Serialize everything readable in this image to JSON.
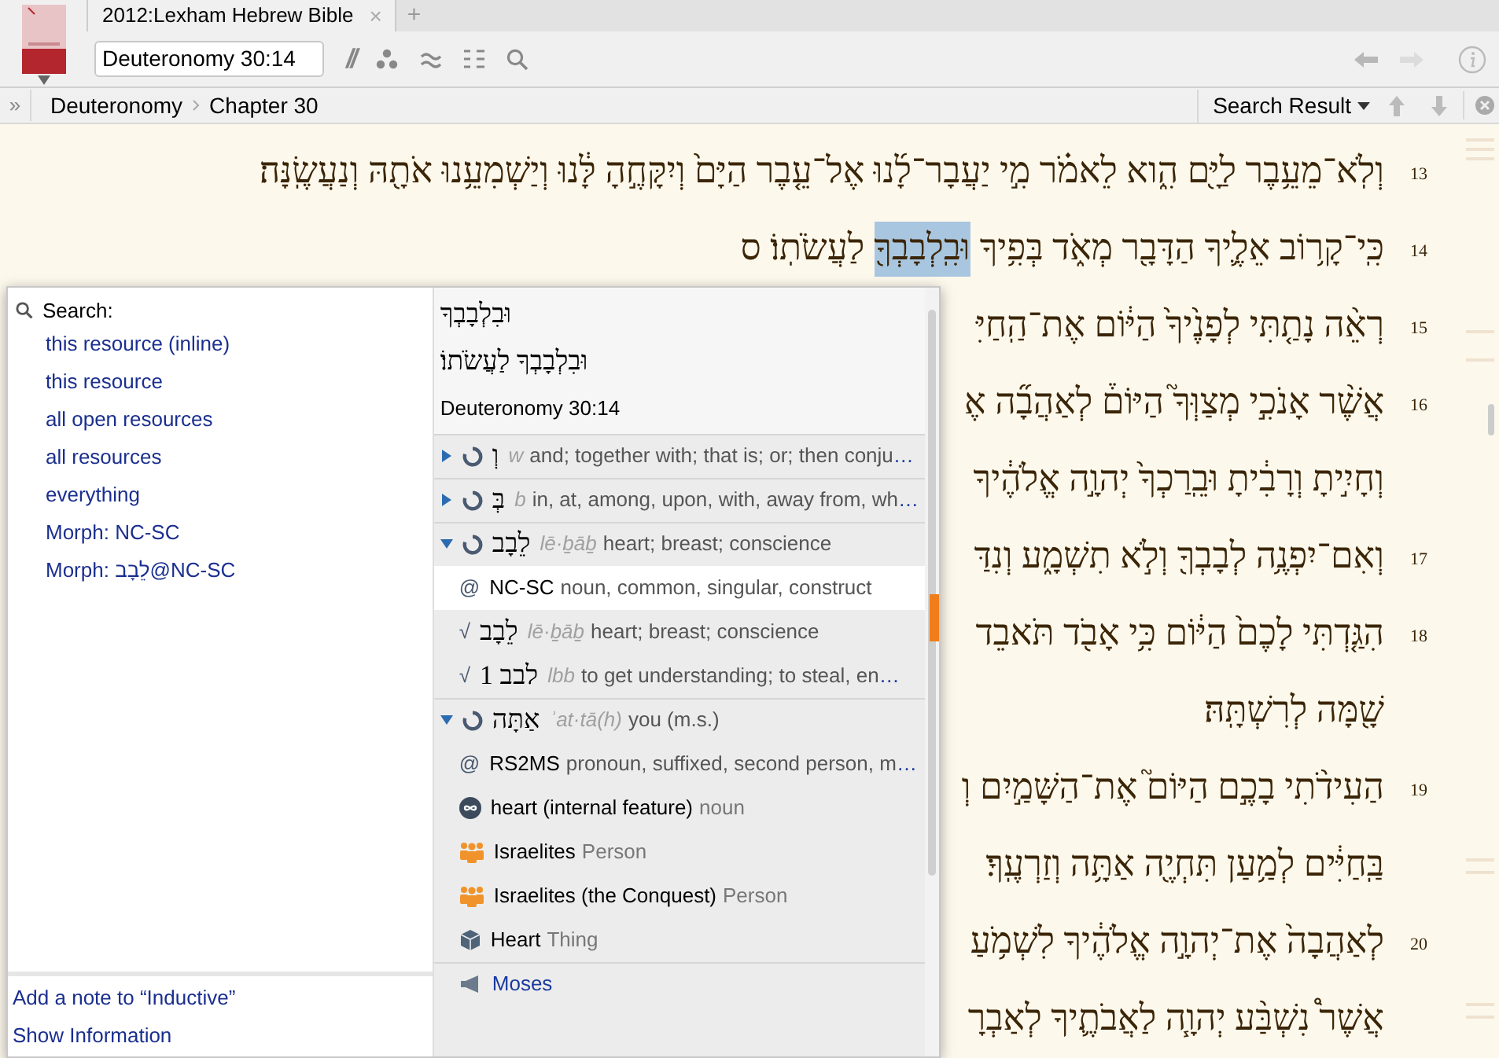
{
  "tabs": [
    {
      "label": "2012:Lexham Hebrew Bible",
      "selected": true,
      "close": "×"
    }
  ],
  "new_tab": "+",
  "reference_field": {
    "value": "Deuteronomy 30:14"
  },
  "parallel_glyph": "//",
  "breadcrumb": {
    "expand": "»",
    "book": "Deuteronomy",
    "chapter": "Chapter 30"
  },
  "search_result": {
    "label": "Search Result"
  },
  "verses": [
    {
      "number": "13",
      "segments": [
        {
          "text": "וְלֹֽא־מֵעֵ֥בֶר לַיָּ֖ם הִ֑וא לֵאמֹ֗ר מִ֣י יַעֲבָר־לָ֜נוּ אֶל־עֵ֤בֶר הַיָּם֙ וְיִקָּחֶ֣הָ לָּ֔נוּ וְיַשְׁמִעֵ֥נוּ אֹתָ֖הּ וְנַעֲשֶֽׂנָּה׃",
          "highlighted": false
        }
      ]
    },
    {
      "number": "14",
      "segments": [
        {
          "text": "כִּֽי־קָר֥וֹב אֵלֶ֛יךָ הַדָּבָ֖ר מְאֹ֑ד בְּפִ֥יךָ",
          "highlighted": false
        },
        {
          "text": "וּבִֽלְבָבְךָ֖",
          "highlighted": true
        },
        {
          "text": "לַעֲשֹׂתֽוֹ׃ ס",
          "highlighted": false
        }
      ]
    },
    {
      "number": "15",
      "segments": [
        {
          "text": "רְאֵ֨ה נָתַ֤תִּי לְפָנֶ֙יךָ֙ הַיּ֔וֹם אֶת־הַֽחַיִּ",
          "highlighted": false
        }
      ]
    },
    {
      "number": "16",
      "segments": [
        {
          "text": "אֲשֶׁ֨ר אָנֹכִ֣י מְצַוְּךָ֮ הַיּוֹם֒ לְאַהֲבָ֞ה אֶ",
          "highlighted": false
        }
      ]
    },
    {
      "segments": [
        {
          "text": "וְחָיִ֣יתָ וְרָבִ֔יתָ וּבֵֽרַכְךָ֙ יְהוָ֣ה אֱלֹהֶ֔יךָ",
          "highlighted": false
        }
      ]
    },
    {
      "number": "17",
      "segments": [
        {
          "text": "וְאִם־יִפְנֶ֥ה לְבָבְךָ֖ וְלֹ֣א תִשְׁמָ֑ע וְנִדַּ",
          "highlighted": false
        }
      ]
    },
    {
      "number": "18",
      "segments": [
        {
          "text": "הִגַּ֤דְתִּי לָכֶם֙ הַיּ֔וֹם כִּ֥י אָבֹ֖ד תֹּאבֵד",
          "highlighted": false
        }
      ]
    },
    {
      "segments": [
        {
          "text": "שָׁ֖מָּה לְרִשְׁתָּֽהּ׃",
          "highlighted": false
        }
      ]
    },
    {
      "number": "19",
      "segments": [
        {
          "text": "הַעִידֹ֨תִי בָכֶ֣ם הַיּוֹם֮ אֶת־הַשָּׁמַ֣יִם וְ",
          "highlighted": false
        }
      ]
    },
    {
      "segments": [
        {
          "text": "בַּֽחַיִּ֔ים לְמַ֥עַן תִּחְיֶ֖ה אַתָּ֥ה וְזַרְעֶֽךָ׃",
          "highlighted": false
        }
      ]
    },
    {
      "number": "20",
      "segments": [
        {
          "text": "לְאַהֲבָה֙ אֶת־יְהוָ֣ה אֱלֹהֶ֔יךָ לִשְׁמֹ֥עַ",
          "highlighted": false
        }
      ]
    },
    {
      "segments": [
        {
          "text": "אֲשֶׁר֩ נִשְׁבַּ֨ע יְהוָ֧ה לַאֲבֹתֶ֛יךָ לְאַבְרָ",
          "highlighted": false
        }
      ]
    }
  ],
  "popup": {
    "search_label": "Search:",
    "search_options": [
      "this resource (inline)",
      "this resource",
      "all open resources",
      "all resources",
      "everything",
      "Morph: NC-SC",
      "Morph: לֵבָב@NC-SC"
    ],
    "footer_links": [
      "Add a note to “Inductive”",
      "Show Information"
    ],
    "word": {
      "headword": "וּבִלְבָבְךָ",
      "phrase": "וּבִלְבָבְךָ לַעֲשֹׂתוֹ׃",
      "reference": "Deuteronomy 30:14"
    },
    "rows": [
      {
        "kind": "lemma",
        "expanded": false,
        "selected": false,
        "hebrew": "וְ",
        "translit": "w",
        "gloss": "and; together with; that is; or; then conju",
        "more": "…"
      },
      {
        "kind": "lemma",
        "expanded": false,
        "selected": false,
        "hebrew": "בְּ",
        "translit": "b",
        "gloss": "in, at, among, upon, with, away from, wh",
        "more": "…"
      },
      {
        "kind": "lemma",
        "expanded": true,
        "selected": false,
        "hebrew": "לֵבָב",
        "translit": "lē·ḇāḇ",
        "gloss": "heart; breast; conscience"
      },
      {
        "kind": "morph",
        "selected": true,
        "marker": "@",
        "code": "NC-SC",
        "gloss": "noun, common, singular, construct"
      },
      {
        "kind": "root",
        "selected": false,
        "marker": "√",
        "hebrew": "לֵבָב",
        "translit": "lē·ḇāḇ",
        "gloss": "heart; breast; conscience"
      },
      {
        "kind": "root",
        "selected": false,
        "marker": "√",
        "hebrew": "לבב 1",
        "translit": "lbb",
        "gloss": "to get understanding; to steal, en",
        "more": "…"
      },
      {
        "kind": "lemma",
        "expanded": true,
        "selected": false,
        "hebrew": "אַתָּה",
        "translit": "ʾat·tā(h)",
        "gloss": "you (m.s.)"
      },
      {
        "kind": "morph",
        "selected": false,
        "marker": "@",
        "code": "RS2MS",
        "gloss": "pronoun, suffixed, second person, m",
        "more": "…"
      },
      {
        "kind": "sense",
        "selected": false,
        "name": "heart (internal feature)",
        "type": "noun"
      },
      {
        "kind": "person",
        "selected": false,
        "name": "Israelites",
        "type": "Person"
      },
      {
        "kind": "person",
        "selected": false,
        "name": "Israelites (the Conquest)",
        "type": "Person"
      },
      {
        "kind": "thing",
        "selected": false,
        "name": "Heart",
        "type": "Thing"
      },
      {
        "kind": "section",
        "selected": false,
        "name": "Moses"
      }
    ]
  }
}
